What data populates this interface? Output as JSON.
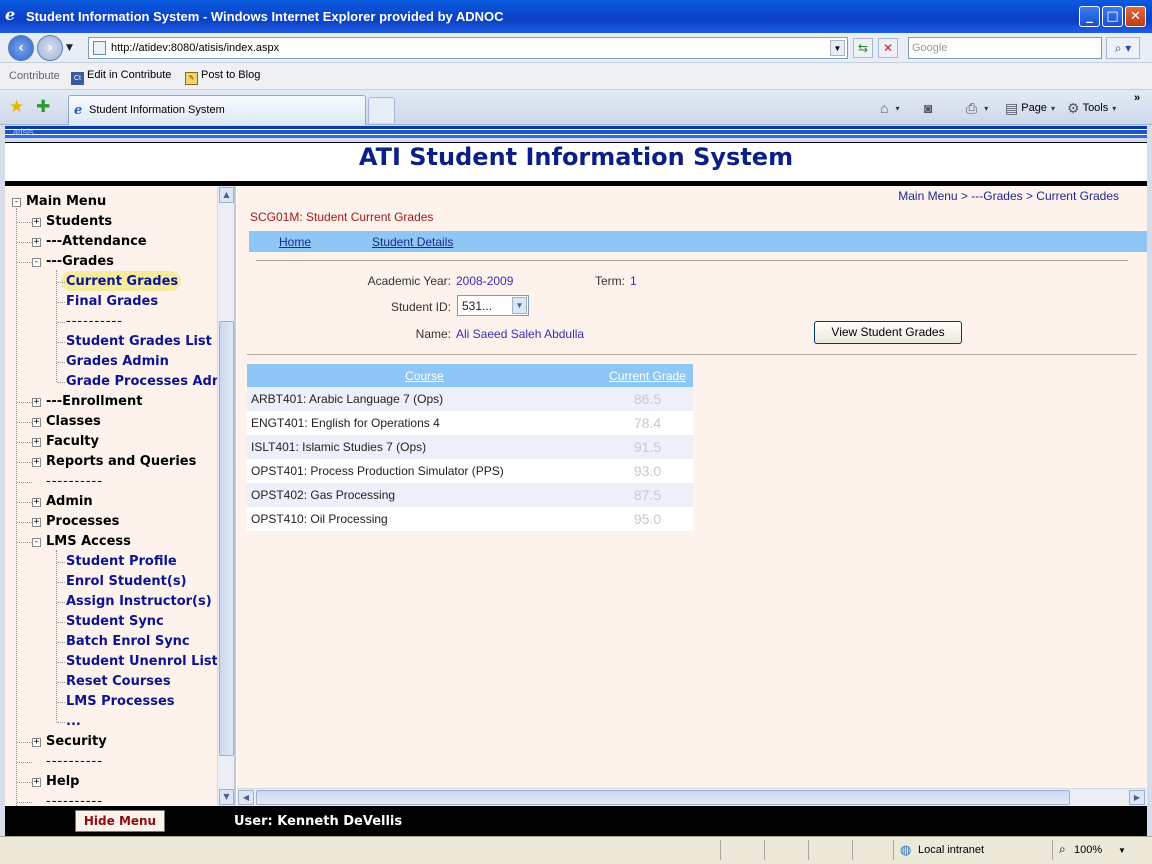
{
  "window": {
    "title": "Student Information System - Windows Internet Explorer provided by ADNOC"
  },
  "address_bar": {
    "url": "http://atidev:8080/atisis/index.aspx",
    "search_placeholder": "Google"
  },
  "contribute_bar": {
    "label": "Contribute",
    "edit_label": "Edit in Contribute",
    "blog_label": "Post to Blog"
  },
  "tabs": [
    {
      "label": "Student Information System"
    }
  ],
  "command_bar": {
    "page_label": "Page",
    "tools_label": "Tools"
  },
  "app": {
    "corner_text": "atisis",
    "title": "ATI Student Information System"
  },
  "menu": {
    "root": "Main Menu",
    "items": [
      {
        "label": "Students",
        "level": 1,
        "toggle": "+"
      },
      {
        "label": "---Attendance",
        "level": 1,
        "toggle": "+"
      },
      {
        "label": "---Grades",
        "level": 1,
        "toggle": "-"
      },
      {
        "label": "Current Grades",
        "level": 2,
        "selected": true
      },
      {
        "label": "Final Grades",
        "level": 2
      },
      {
        "label": "----------",
        "level": 2,
        "separator": true
      },
      {
        "label": "Student Grades List",
        "level": 2
      },
      {
        "label": "Grades Admin",
        "level": 2
      },
      {
        "label": "Grade Processes Admin",
        "level": 2
      },
      {
        "label": "---Enrollment",
        "level": 1,
        "toggle": "+"
      },
      {
        "label": "Classes",
        "level": 1,
        "toggle": "+"
      },
      {
        "label": "Faculty",
        "level": 1,
        "toggle": "+"
      },
      {
        "label": "Reports and Queries",
        "level": 1,
        "toggle": "+"
      },
      {
        "label": "----------",
        "level": 1,
        "separator": true
      },
      {
        "label": "Admin",
        "level": 1,
        "toggle": "+"
      },
      {
        "label": "Processes",
        "level": 1,
        "toggle": "+"
      },
      {
        "label": "LMS Access",
        "level": 1,
        "toggle": "-"
      },
      {
        "label": "Student Profile",
        "level": 2
      },
      {
        "label": "Enrol Student(s)",
        "level": 2
      },
      {
        "label": "Assign Instructor(s)",
        "level": 2
      },
      {
        "label": "Student Sync",
        "level": 2
      },
      {
        "label": "Batch Enrol Sync",
        "level": 2
      },
      {
        "label": "Student Unenrol List",
        "level": 2
      },
      {
        "label": "Reset Courses",
        "level": 2
      },
      {
        "label": "LMS Processes",
        "level": 2
      },
      {
        "label": "...",
        "level": 2
      },
      {
        "label": "Security",
        "level": 1,
        "toggle": "+"
      },
      {
        "label": "----------",
        "level": 1,
        "separator": true
      },
      {
        "label": "Help",
        "level": 1,
        "toggle": "+"
      },
      {
        "label": "----------",
        "level": 1,
        "separator": true
      }
    ]
  },
  "breadcrumb": "Main Menu > ---Grades > Current Grades",
  "form_code": "SCG01M: Student Current Grades",
  "links": {
    "home": "Home",
    "student_details": "Student Details"
  },
  "student": {
    "academic_year_label": "Academic Year:",
    "academic_year": "2008-2009",
    "term_label": "Term:",
    "term": "1",
    "id_label": "Student ID:",
    "id_value": "531...",
    "name_label": "Name:",
    "name": "Ali Saeed Saleh Abdulla"
  },
  "view_button": "View Student Grades",
  "grades_table": {
    "headers": [
      "Course",
      "Current Grade"
    ],
    "rows": [
      {
        "course": "ARBT401: Arabic Language 7 (Ops)",
        "grade": "86.5"
      },
      {
        "course": "ENGT401: English for Operations 4",
        "grade": "78.4"
      },
      {
        "course": "ISLT401: Islamic Studies 7 (Ops)",
        "grade": "91.5"
      },
      {
        "course": "OPST401: Process Production Simulator (PPS)",
        "grade": "93.0"
      },
      {
        "course": "OPST402: Gas Processing",
        "grade": "87.5"
      },
      {
        "course": "OPST410: Oil Processing",
        "grade": "95.0"
      }
    ]
  },
  "footer": {
    "hide_menu": "Hide Menu",
    "user": "User: Kenneth DeVellis"
  },
  "status_bar": {
    "zone": "Local intranet",
    "zoom": "100%"
  },
  "colors": {
    "title_blue": "#0c1f86",
    "link_bar": "#8ec6f6",
    "panel_bg": "#fdf2ec",
    "form_code_red": "#a51a1a"
  },
  "icons": [
    "back-icon",
    "forward-icon",
    "refresh-icon",
    "stop-icon",
    "search-icon",
    "favorites-star-icon",
    "add-favorites-icon",
    "home-icon",
    "feeds-icon",
    "print-icon",
    "page-icon",
    "tools-gear-icon",
    "globe-icon",
    "zoom-icon"
  ]
}
